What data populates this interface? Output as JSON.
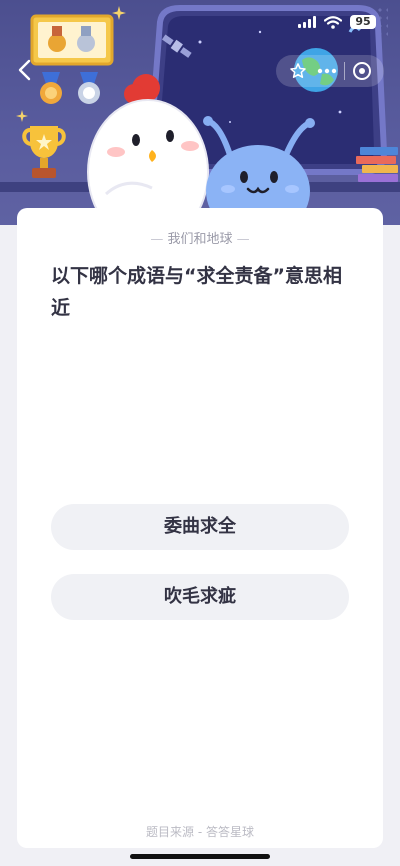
{
  "status_bar": {
    "battery": "95"
  },
  "card": {
    "tag": "我们和地球",
    "question": "以下哪个成语与“求全责备”意思相近",
    "options": [
      {
        "label": "委曲求全"
      },
      {
        "label": "吹毛求疵"
      }
    ],
    "source": "题目来源 - 答答星球"
  },
  "colors": {
    "hero_bg": "#595c9e",
    "card_bg": "#ffffff",
    "option_bg": "#f0f1f5",
    "text_primary": "#333344",
    "text_muted": "#9a9aa8"
  }
}
